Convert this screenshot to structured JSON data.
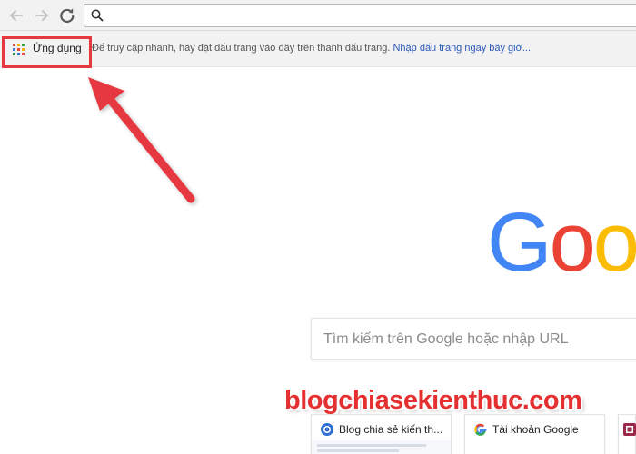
{
  "toolbar": {
    "back_icon": "back-arrow-icon",
    "forward_icon": "forward-arrow-icon",
    "reload_icon": "reload-icon",
    "omnibox_icon": "search-icon",
    "omnibox_value": ""
  },
  "bookmarks_bar": {
    "apps_label": "Ứng dụng",
    "hint_text": "Để truy cập nhanh, hãy đặt dấu trang vào đây trên thanh dấu trang.",
    "import_link": "Nhập dấu trang ngay bây giờ..."
  },
  "new_tab": {
    "logo_letters": [
      "G",
      "o",
      "o"
    ],
    "search_placeholder": "Tìm kiếm trên Google hoặc nhập URL",
    "tiles": [
      {
        "title": "Blog chia sẻ kiến th...",
        "icon": "blog-favicon"
      },
      {
        "title": "Tài khoản Google",
        "icon": "google-g-icon"
      },
      {
        "title": "",
        "icon": "site-favicon"
      }
    ]
  },
  "annotations": {
    "highlight_color": "#e5393f",
    "arrow_color": "#e5393f"
  },
  "watermark": "blogchiasekienthuc.com",
  "colors": {
    "google_blue": "#4285f4",
    "google_red": "#ea4335",
    "google_yellow": "#fbbc05",
    "link_blue": "#2a58b8"
  }
}
